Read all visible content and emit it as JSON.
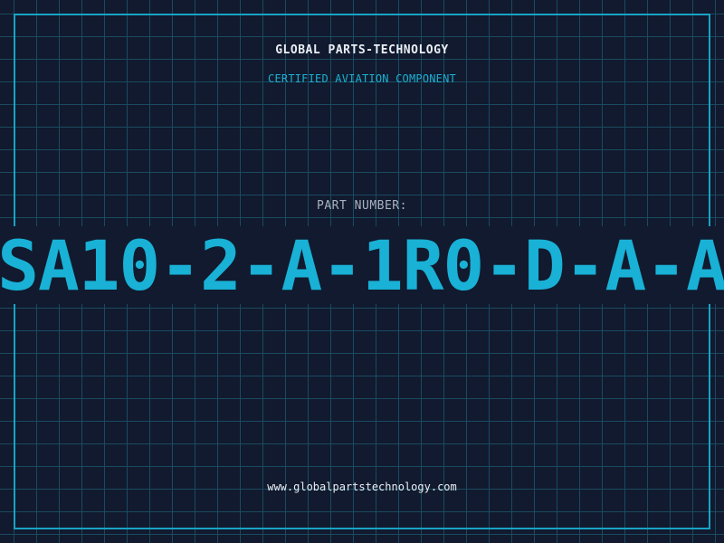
{
  "header": {
    "company": "GLOBAL PARTS-TECHNOLOGY",
    "subtitle": "CERTIFIED AVIATION COMPONENT"
  },
  "part": {
    "label": "PART NUMBER:",
    "number": "SA10-2-A-1R0-D-A-A"
  },
  "footer": {
    "url": "www.globalpartstechnology.com"
  },
  "colors": {
    "background": "#111a2e",
    "grid": "#1b4a60",
    "accent": "#19b1d6",
    "title_text": "#e9eef5",
    "label_text": "#a9b3c0"
  }
}
